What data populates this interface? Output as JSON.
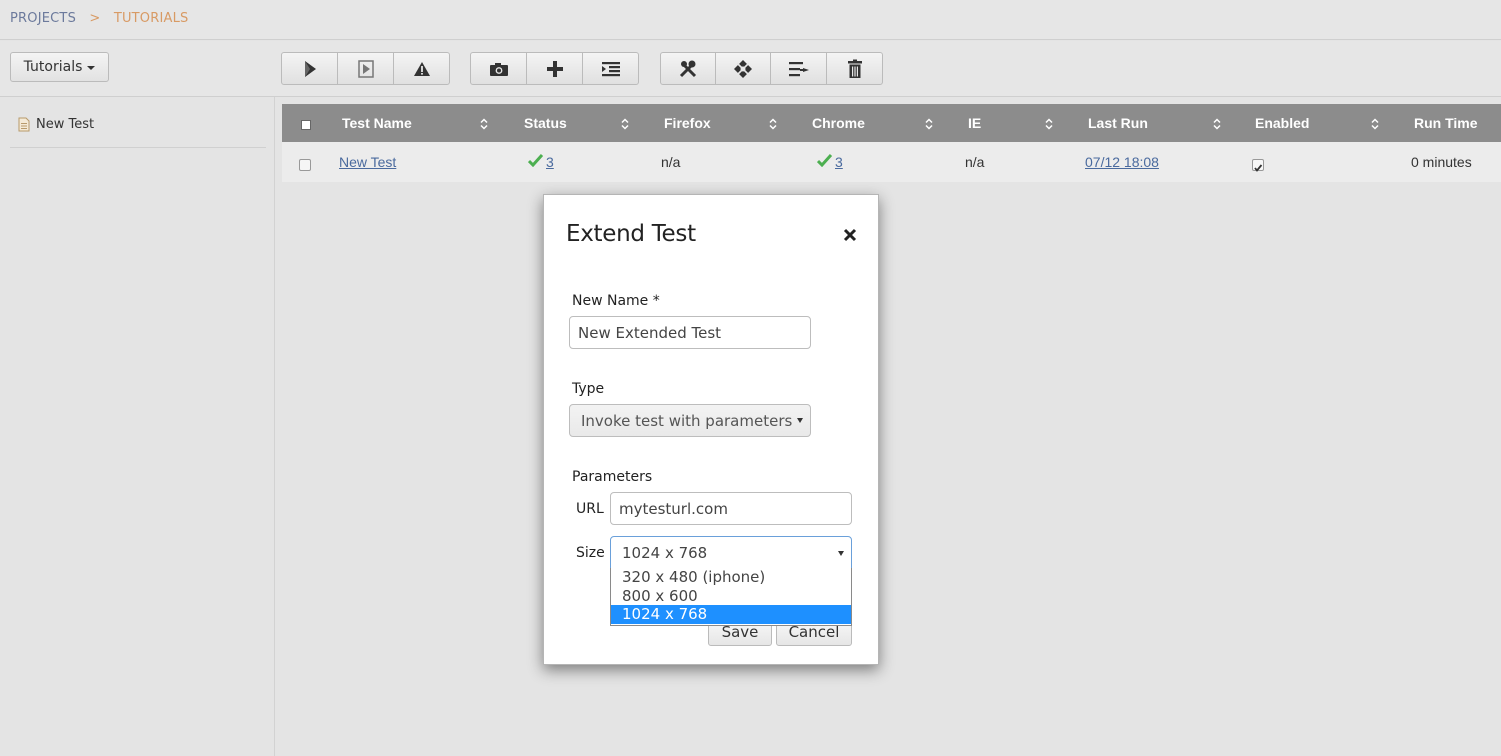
{
  "breadcrumb": {
    "root": "PROJECTS",
    "separator": ">",
    "current": "TUTORIALS"
  },
  "toolbar": {
    "project_dropdown_label": "Tutorials"
  },
  "sidebar": {
    "items": [
      {
        "label": "New Test"
      }
    ]
  },
  "table": {
    "columns": [
      "Test Name",
      "Status",
      "Firefox",
      "Chrome",
      "IE",
      "Last Run",
      "Enabled",
      "Run Time"
    ],
    "rows": [
      {
        "test_name": "New Test",
        "status": "3",
        "firefox": "n/a",
        "chrome": "3",
        "ie": "n/a",
        "last_run": "07/12 18:08",
        "enabled": true,
        "run_time": "0 minutes"
      }
    ]
  },
  "modal": {
    "title": "Extend Test",
    "new_name_label": "New Name *",
    "new_name_value": "New Extended Test",
    "type_label": "Type",
    "type_value": "Invoke test with parameters",
    "parameters_label": "Parameters",
    "url_label": "URL",
    "url_value": "mytesturl.com",
    "size_label": "Size",
    "size_value": "1024 x 768",
    "size_options": [
      "320 x 480 (iphone)",
      "800 x 600",
      "1024 x 768"
    ],
    "save_label": "Save",
    "cancel_label": "Cancel"
  },
  "colors": {
    "header_bg": "#8c8c8c",
    "status_ok": "#4caf50",
    "link": "#4a6a9e",
    "selected_option": "#1e90ff",
    "breadcrumb_current": "#d89a64"
  },
  "icons": [
    "play-all-icon",
    "play-selected-icon",
    "warning-icon",
    "camera-icon",
    "plus-icon",
    "indent-icon",
    "tools-icon",
    "settings-icon",
    "move-icon",
    "trash-icon",
    "file-icon",
    "checkmark-icon",
    "sort-icon",
    "close-icon"
  ]
}
